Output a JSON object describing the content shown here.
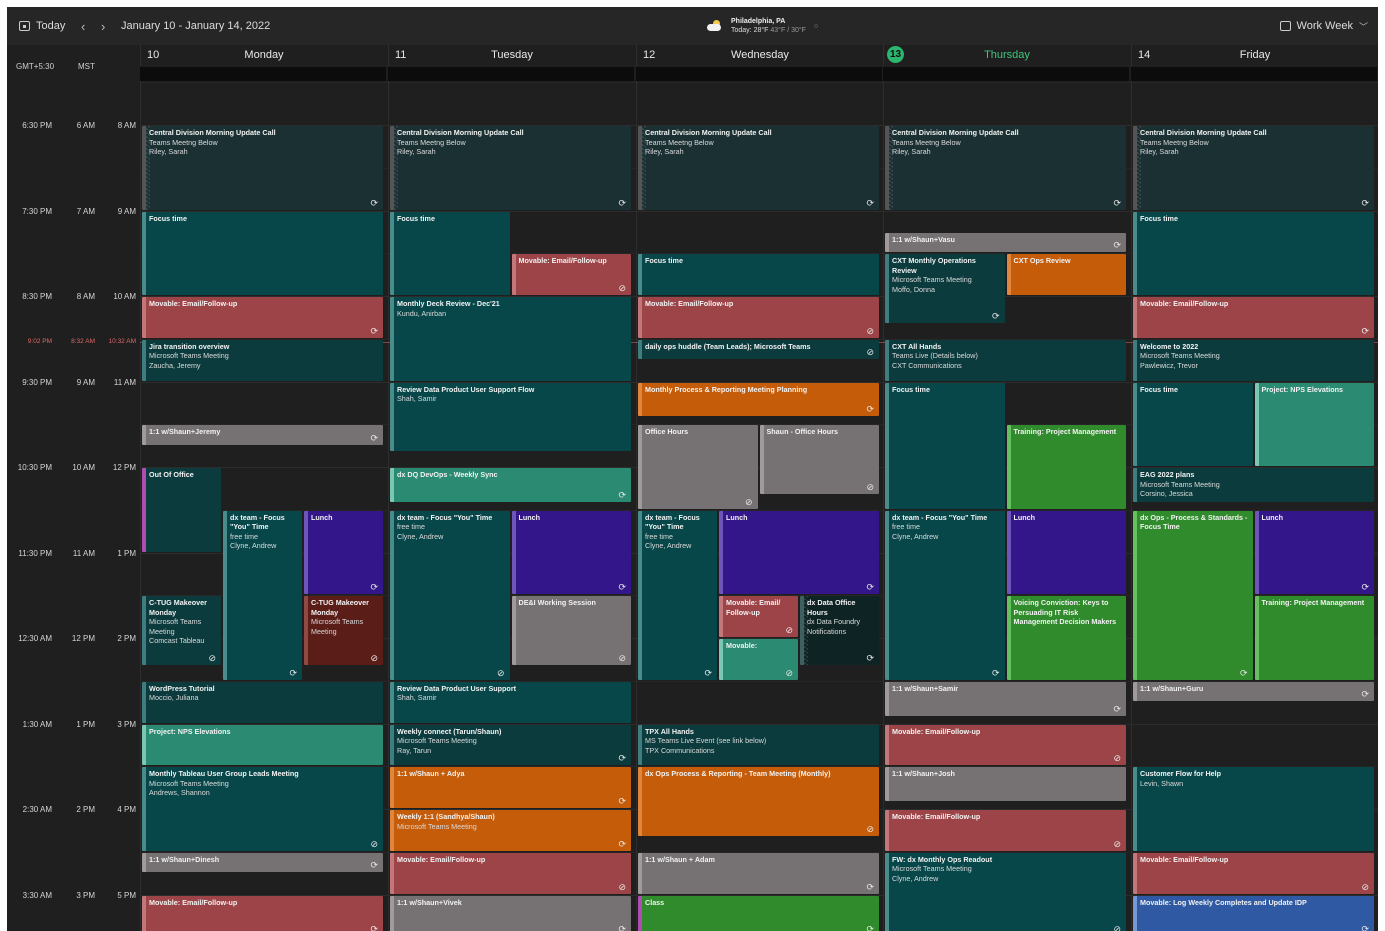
{
  "toolbar": {
    "today_label": "Today",
    "prev_icon": "chevron-left-icon",
    "next_icon": "chevron-right-icon",
    "date_range": "January 10 - January 14, 2022",
    "weather": {
      "icon": "partly-cloudy-icon",
      "location": "Philadelphia, PA",
      "today_prefix": "Today: 28°F",
      "range": "43°F / 30°F"
    },
    "view_label": "Work Week"
  },
  "timezones": {
    "tz1": "GMT+5:30",
    "tz2": "MST",
    "tz3": ""
  },
  "days": [
    {
      "num": "10",
      "name": "Monday"
    },
    {
      "num": "11",
      "name": "Tuesday"
    },
    {
      "num": "12",
      "name": "Wednesday"
    },
    {
      "num": "13",
      "name": "Thursday",
      "today": true
    },
    {
      "num": "14",
      "name": "Friday"
    }
  ],
  "times": [
    {
      "ist": "6:30 PM",
      "mst": "6 AM",
      "local": "8 AM"
    },
    {
      "ist": "7:30 PM",
      "mst": "7 AM",
      "local": "9 AM"
    },
    {
      "ist": "8:30 PM",
      "mst": "8 AM",
      "local": "10 AM"
    },
    {
      "ist": "9:30 PM",
      "mst": "9 AM",
      "local": "11 AM"
    },
    {
      "ist": "10:30 PM",
      "mst": "10 AM",
      "local": "12 PM"
    },
    {
      "ist": "11:30 PM",
      "mst": "11 AM",
      "local": "1 PM"
    },
    {
      "ist": "12:30 AM",
      "mst": "12 PM",
      "local": "2 PM"
    },
    {
      "ist": "1:30 AM",
      "mst": "1 PM",
      "local": "3 PM"
    },
    {
      "ist": "2:30 AM",
      "mst": "2 PM",
      "local": "4 PM"
    },
    {
      "ist": "3:30 AM",
      "mst": "3 PM",
      "local": "5 PM"
    }
  ],
  "now": {
    "ist": "9:02 PM",
    "mst": "8:32 AM",
    "local": "10:32 AM"
  },
  "colors": {
    "today_accent": "#2bb56f",
    "now_line": "#c06060",
    "teal": "#07474a",
    "red": "#9c4447",
    "orange": "#c55c0a",
    "green": "#2f8b2b",
    "purple": "#32168a",
    "gray": "#767172",
    "blue": "#2f5aa3"
  },
  "events": [
    {
      "day": 0,
      "start": 8.0,
      "end": 9.0,
      "col": 0,
      "cols": 1,
      "color": "hdr",
      "hatch": true,
      "title": "Central Division Morning Update Call",
      "lines": [
        "Teams Meetng Below",
        "Riley, Sarah"
      ],
      "icon": "⟳"
    },
    {
      "day": 0,
      "start": 9.0,
      "end": 10.0,
      "col": 0,
      "cols": 1,
      "color": "teal",
      "title": "Focus time",
      "lines": []
    },
    {
      "day": 0,
      "start": 10.0,
      "end": 10.5,
      "col": 0,
      "cols": 1,
      "color": "red",
      "title": "Movable: Email/Follow-up",
      "lines": [],
      "icon": "⟳"
    },
    {
      "day": 0,
      "start": 10.5,
      "end": 11.0,
      "col": 0,
      "cols": 1,
      "color": "dteal",
      "title": "Jira transition overview",
      "lines": [
        "Microsoft Teams Meeting",
        "Zaucha, Jeremy"
      ]
    },
    {
      "day": 0,
      "start": 11.5,
      "end": 11.75,
      "col": 0,
      "cols": 1,
      "color": "gray",
      "title": "1:1 w/Shaun+Jeremy",
      "lines": [],
      "icon": "⟳"
    },
    {
      "day": 0,
      "start": 12.0,
      "end": 13.0,
      "col": 0,
      "cols": 3,
      "color": "ooo",
      "title": "Out Of Office",
      "lines": []
    },
    {
      "day": 0,
      "start": 12.5,
      "end": 14.5,
      "col": 1,
      "cols": 3,
      "color": "teal",
      "title": "dx team - Focus \"You\" Time",
      "lines": [
        "free time",
        "Clyne, Andrew"
      ],
      "icon": "⟳"
    },
    {
      "day": 0,
      "start": 12.5,
      "end": 13.5,
      "col": 2,
      "cols": 3,
      "color": "purple",
      "title": "Lunch",
      "lines": [],
      "icon": "⟳"
    },
    {
      "day": 0,
      "start": 13.5,
      "end": 14.33,
      "col": 0,
      "cols": 3,
      "color": "dteal",
      "title": "C-TUG Makeover Monday",
      "lines": [
        "Microsoft Teams Meeting",
        "Comcast Tableau"
      ],
      "icon": "⊘"
    },
    {
      "day": 0,
      "start": 13.5,
      "end": 14.33,
      "col": 2,
      "cols": 3,
      "color": "maroon",
      "title": "C-TUG Makeover Monday",
      "lines": [
        "Microsoft Teams Meeting"
      ],
      "icon": "⊘"
    },
    {
      "day": 0,
      "start": 14.5,
      "end": 15.0,
      "col": 0,
      "cols": 1,
      "color": "dteal",
      "title": "WordPress Tutorial",
      "lines": [
        "Moccio, Juliana"
      ]
    },
    {
      "day": 0,
      "start": 15.0,
      "end": 15.5,
      "col": 0,
      "cols": 1,
      "color": "mint",
      "title": "Project: NPS Elevations",
      "lines": []
    },
    {
      "day": 0,
      "start": 15.5,
      "end": 16.5,
      "col": 0,
      "cols": 1,
      "color": "teal",
      "title": "Monthly Tableau User Group Leads Meeting",
      "lines": [
        "Microsoft Teams Meeting",
        "Andrews, Shannon"
      ],
      "icon": "⊘"
    },
    {
      "day": 0,
      "start": 16.5,
      "end": 16.75,
      "col": 0,
      "cols": 1,
      "color": "gray",
      "title": "1:1 w/Shaun+Dinesh",
      "lines": [],
      "icon": "⟳"
    },
    {
      "day": 0,
      "start": 17.0,
      "end": 17.5,
      "col": 0,
      "cols": 1,
      "color": "red",
      "title": "Movable: Email/Follow-up",
      "lines": [],
      "icon": "⟳"
    },
    {
      "day": 1,
      "start": 8.0,
      "end": 9.0,
      "col": 0,
      "cols": 1,
      "color": "hdr",
      "hatch": true,
      "title": "Central Division Morning Update Call",
      "lines": [
        "Teams Meetng Below",
        "Riley, Sarah"
      ],
      "icon": "⟳"
    },
    {
      "day": 1,
      "start": 9.0,
      "end": 10.0,
      "col": 0,
      "cols": 2,
      "color": "teal",
      "title": "Focus time",
      "lines": []
    },
    {
      "day": 1,
      "start": 9.5,
      "end": 10.0,
      "col": 1,
      "cols": 2,
      "color": "red",
      "title": "Movable: Email/Follow-up",
      "lines": [],
      "icon": "⊘"
    },
    {
      "day": 1,
      "start": 10.0,
      "end": 11.0,
      "col": 0,
      "cols": 1,
      "color": "teal",
      "title": "Monthly Deck Review - Dec'21",
      "lines": [
        "Kundu, Anirban"
      ]
    },
    {
      "day": 1,
      "start": 11.0,
      "end": 11.83,
      "col": 0,
      "cols": 1,
      "color": "teal",
      "title": "Review Data Product User Support Flow",
      "lines": [
        "Shah, Samir"
      ]
    },
    {
      "day": 1,
      "start": 12.0,
      "end": 12.42,
      "col": 0,
      "cols": 1,
      "color": "mint",
      "title": "dx DQ DevOps - Weekly Sync",
      "lines": [],
      "icon": "⟳"
    },
    {
      "day": 1,
      "start": 12.5,
      "end": 14.5,
      "col": 0,
      "cols": 2,
      "color": "teal",
      "title": "dx team - Focus \"You\" Time",
      "lines": [
        "free time",
        "Clyne, Andrew"
      ],
      "icon": "⊘"
    },
    {
      "day": 1,
      "start": 12.5,
      "end": 13.5,
      "col": 1,
      "cols": 2,
      "color": "purple",
      "title": "Lunch",
      "lines": [],
      "icon": "⟳"
    },
    {
      "day": 1,
      "start": 13.5,
      "end": 14.33,
      "col": 1,
      "cols": 2,
      "color": "gray",
      "title": "DE&I Working Session",
      "lines": [],
      "icon": "⊘"
    },
    {
      "day": 1,
      "start": 14.5,
      "end": 15.0,
      "col": 0,
      "cols": 1,
      "color": "teal",
      "title": "Review Data Product User Support",
      "lines": [
        "Shah, Samir"
      ]
    },
    {
      "day": 1,
      "start": 15.0,
      "end": 15.5,
      "col": 0,
      "cols": 1,
      "color": "dteal",
      "title": "Weekly connect (Tarun/Shaun)",
      "lines": [
        "Microsoft Teams Meeting",
        "Ray, Tarun"
      ],
      "icon": "⟳"
    },
    {
      "day": 1,
      "start": 15.5,
      "end": 16.0,
      "col": 0,
      "cols": 1,
      "color": "orange",
      "title": "1:1 w/Shaun + Adya",
      "lines": [],
      "icon": "⟳"
    },
    {
      "day": 1,
      "start": 16.0,
      "end": 16.5,
      "col": 0,
      "cols": 1,
      "color": "orange",
      "title": "Weekly 1:1 (Sandhya/Shaun)",
      "lines": [
        "Microsoft Teams Meeting"
      ],
      "icon": "⟳"
    },
    {
      "day": 1,
      "start": 16.5,
      "end": 17.0,
      "col": 0,
      "cols": 1,
      "color": "red",
      "title": "Movable: Email/Follow-up",
      "lines": [],
      "icon": "⊘"
    },
    {
      "day": 1,
      "start": 17.0,
      "end": 17.5,
      "col": 0,
      "cols": 1,
      "color": "gray",
      "title": "1:1 w/Shaun+Vivek",
      "lines": [],
      "icon": "⟳"
    },
    {
      "day": 2,
      "start": 8.0,
      "end": 9.0,
      "col": 0,
      "cols": 1,
      "color": "hdr",
      "hatch": true,
      "title": "Central Division Morning Update Call",
      "lines": [
        "Teams Meetng Below",
        "Riley, Sarah"
      ],
      "icon": "⟳"
    },
    {
      "day": 2,
      "start": 9.5,
      "end": 10.0,
      "col": 0,
      "cols": 1,
      "color": "teal",
      "title": "Focus time",
      "lines": []
    },
    {
      "day": 2,
      "start": 10.0,
      "end": 10.5,
      "col": 0,
      "cols": 1,
      "color": "red",
      "title": "Movable: Email/Follow-up",
      "lines": [],
      "icon": "⊘"
    },
    {
      "day": 2,
      "start": 10.5,
      "end": 10.75,
      "col": 0,
      "cols": 1,
      "color": "dteal",
      "title": "daily ops huddle (Team Leads); Microsoft Teams",
      "lines": [],
      "icon": "⊘"
    },
    {
      "day": 2,
      "start": 11.0,
      "end": 11.42,
      "col": 0,
      "cols": 1,
      "color": "orange",
      "title": "Monthly Process & Reporting Meeting Planning",
      "lines": [],
      "icon": "⟳"
    },
    {
      "day": 2,
      "start": 11.5,
      "end": 12.5,
      "col": 0,
      "cols": 2,
      "color": "gray",
      "title": "Office Hours",
      "lines": [],
      "icon": "⊘"
    },
    {
      "day": 2,
      "start": 11.5,
      "end": 12.33,
      "col": 1,
      "cols": 2,
      "color": "gray",
      "title": "Shaun - Office Hours",
      "lines": [],
      "icon": "⊘"
    },
    {
      "day": 2,
      "start": 12.5,
      "end": 14.5,
      "col": 0,
      "cols": 3,
      "color": "teal",
      "title": "dx team - Focus \"You\" Time",
      "lines": [
        "free time",
        "Clyne, Andrew"
      ],
      "icon": "⟳"
    },
    {
      "day": 2,
      "start": 12.5,
      "end": 13.5,
      "col": 1,
      "cols": 3,
      "span": 2,
      "color": "purple",
      "title": "Lunch",
      "lines": [],
      "icon": "⟳"
    },
    {
      "day": 2,
      "start": 13.5,
      "end": 14.0,
      "col": 1,
      "cols": 3,
      "color": "red",
      "title": "Movable: Email/ Follow-up",
      "lines": [],
      "icon": "⊘"
    },
    {
      "day": 2,
      "start": 13.5,
      "end": 14.33,
      "col": 2,
      "cols": 3,
      "color": "dark",
      "hatch": true,
      "title": "dx Data Office Hours",
      "lines": [
        "dx Data Foundry Notifications"
      ],
      "icon": "⟳"
    },
    {
      "day": 2,
      "start": 14.0,
      "end": 14.5,
      "col": 1,
      "cols": 3,
      "color": "mint",
      "title": "Movable:",
      "lines": [],
      "icon": "⊘"
    },
    {
      "day": 2,
      "start": 15.0,
      "end": 15.5,
      "col": 0,
      "cols": 1,
      "color": "dteal",
      "title": "TPX All Hands",
      "lines": [
        "MS Teams Live Event (see link below)",
        "TPX Communications"
      ]
    },
    {
      "day": 2,
      "start": 15.5,
      "end": 16.33,
      "col": 0,
      "cols": 1,
      "color": "orange",
      "title": "dx Ops Process & Reporting - Team Meeting (Monthly)",
      "lines": [],
      "icon": "⊘"
    },
    {
      "day": 2,
      "start": 16.5,
      "end": 17.0,
      "col": 0,
      "cols": 1,
      "color": "gray",
      "title": "1:1 w/Shaun + Adam",
      "lines": [],
      "icon": "⟳"
    },
    {
      "day": 2,
      "start": 17.0,
      "end": 17.5,
      "col": 0,
      "cols": 1,
      "color": "class",
      "title": "Class",
      "lines": [],
      "icon": "⟳"
    },
    {
      "day": 3,
      "start": 8.0,
      "end": 9.0,
      "col": 0,
      "cols": 1,
      "color": "hdr",
      "hatch": true,
      "title": "Central Division Morning Update Call",
      "lines": [
        "Teams Meetng Below",
        "Riley, Sarah"
      ],
      "icon": "⟳"
    },
    {
      "day": 3,
      "start": 9.25,
      "end": 9.5,
      "col": 0,
      "cols": 1,
      "color": "gray",
      "title": "1:1 w/Shaun+Vasu",
      "lines": [],
      "icon": "⟳"
    },
    {
      "day": 3,
      "start": 9.5,
      "end": 10.33,
      "col": 0,
      "cols": 2,
      "color": "dteal",
      "title": "CXT Monthly Operations Review",
      "lines": [
        "Microsoft Teams Meeting",
        "Moffo, Donna"
      ],
      "icon": "⟳"
    },
    {
      "day": 3,
      "start": 9.5,
      "end": 10.0,
      "col": 1,
      "cols": 2,
      "color": "orange",
      "title": "CXT Ops Review",
      "lines": []
    },
    {
      "day": 3,
      "start": 10.5,
      "end": 11.0,
      "col": 0,
      "cols": 1,
      "color": "dteal",
      "title": "CXT All Hands",
      "lines": [
        "Teams Live (Details below)",
        "CXT Communications"
      ]
    },
    {
      "day": 3,
      "start": 11.0,
      "end": 12.5,
      "col": 0,
      "cols": 2,
      "color": "teal",
      "title": "Focus time",
      "lines": []
    },
    {
      "day": 3,
      "start": 11.5,
      "end": 12.5,
      "col": 1,
      "cols": 2,
      "color": "green",
      "title": "Training: Project Management",
      "lines": []
    },
    {
      "day": 3,
      "start": 12.5,
      "end": 14.5,
      "col": 0,
      "cols": 2,
      "color": "teal",
      "title": "dx team - Focus \"You\" Time",
      "lines": [
        "free time",
        "Clyne, Andrew"
      ],
      "icon": "⟳"
    },
    {
      "day": 3,
      "start": 12.5,
      "end": 13.5,
      "col": 1,
      "cols": 2,
      "color": "purple",
      "title": "Lunch",
      "lines": []
    },
    {
      "day": 3,
      "start": 13.5,
      "end": 14.5,
      "col": 1,
      "cols": 2,
      "color": "green",
      "title": "Voicing Conviction: Keys to Persuading IT Risk Management Decision Makers",
      "lines": []
    },
    {
      "day": 3,
      "start": 14.5,
      "end": 14.92,
      "col": 0,
      "cols": 1,
      "color": "gray",
      "title": "1:1 w/Shaun+Samir",
      "lines": [],
      "icon": "⟳"
    },
    {
      "day": 3,
      "start": 15.0,
      "end": 15.5,
      "col": 0,
      "cols": 1,
      "color": "red",
      "title": "Movable: Email/Follow-up",
      "lines": [],
      "icon": "⊘"
    },
    {
      "day": 3,
      "start": 15.5,
      "end": 15.92,
      "col": 0,
      "cols": 1,
      "color": "gray",
      "title": "1:1 w/Shaun+Josh",
      "lines": []
    },
    {
      "day": 3,
      "start": 16.0,
      "end": 16.5,
      "col": 0,
      "cols": 1,
      "color": "red",
      "title": "Movable: Email/Follow-up",
      "lines": [],
      "icon": "⊘"
    },
    {
      "day": 3,
      "start": 16.5,
      "end": 17.5,
      "col": 0,
      "cols": 1,
      "color": "teal",
      "title": "FW: dx Monthly Ops Readout",
      "lines": [
        "Microsoft Teams Meeting",
        "Clyne, Andrew"
      ],
      "icon": "⊘"
    },
    {
      "day": 4,
      "start": 8.0,
      "end": 9.0,
      "col": 0,
      "cols": 1,
      "color": "hdr",
      "hatch": true,
      "title": "Central Division Morning Update Call",
      "lines": [
        "Teams Meetng Below",
        "Riley, Sarah"
      ],
      "icon": "⟳"
    },
    {
      "day": 4,
      "start": 9.0,
      "end": 10.0,
      "col": 0,
      "cols": 1,
      "color": "teal",
      "title": "Focus time",
      "lines": []
    },
    {
      "day": 4,
      "start": 10.0,
      "end": 10.5,
      "col": 0,
      "cols": 1,
      "color": "red",
      "title": "Movable: Email/Follow-up",
      "lines": [],
      "icon": "⟳"
    },
    {
      "day": 4,
      "start": 10.5,
      "end": 11.0,
      "col": 0,
      "cols": 1,
      "color": "dteal",
      "title": "Welcome to 2022",
      "lines": [
        "Microsoft Teams Meeting",
        "Pawlewicz, Trevor"
      ]
    },
    {
      "day": 4,
      "start": 11.0,
      "end": 12.0,
      "col": 0,
      "cols": 2,
      "color": "teal",
      "title": "Focus time",
      "lines": []
    },
    {
      "day": 4,
      "start": 11.0,
      "end": 12.0,
      "col": 1,
      "cols": 2,
      "color": "mint",
      "title": "Project: NPS Elevations",
      "lines": []
    },
    {
      "day": 4,
      "start": 12.0,
      "end": 12.42,
      "col": 0,
      "cols": 1,
      "color": "dteal",
      "title": "EAG 2022 plans",
      "lines": [
        "Microsoft Teams Meeting",
        "Corsino, Jessica"
      ]
    },
    {
      "day": 4,
      "start": 12.5,
      "end": 14.5,
      "col": 0,
      "cols": 2,
      "color": "green",
      "title": "dx Ops - Process & Standards - Focus Time",
      "lines": [],
      "icon": "⟳"
    },
    {
      "day": 4,
      "start": 12.5,
      "end": 13.5,
      "col": 1,
      "cols": 2,
      "color": "purple",
      "title": "Lunch",
      "lines": [],
      "icon": "⟳"
    },
    {
      "day": 4,
      "start": 13.5,
      "end": 14.5,
      "col": 1,
      "cols": 2,
      "color": "green",
      "title": "Training: Project Management",
      "lines": []
    },
    {
      "day": 4,
      "start": 14.5,
      "end": 14.75,
      "col": 0,
      "cols": 1,
      "color": "gray",
      "title": "1:1 w/Shaun+Guru",
      "lines": [],
      "icon": "⟳"
    },
    {
      "day": 4,
      "start": 15.5,
      "end": 16.5,
      "col": 0,
      "cols": 1,
      "color": "teal",
      "title": "Customer Flow for Help",
      "lines": [
        "Levin, Shawn"
      ]
    },
    {
      "day": 4,
      "start": 16.5,
      "end": 17.0,
      "col": 0,
      "cols": 1,
      "color": "red",
      "title": "Movable: Email/Follow-up",
      "lines": [],
      "icon": "⊘"
    },
    {
      "day": 4,
      "start": 17.0,
      "end": 17.5,
      "col": 0,
      "cols": 1,
      "color": "blue",
      "title": "Movable: Log Weekly Completes and Update IDP",
      "lines": [],
      "icon": "⟳"
    }
  ]
}
